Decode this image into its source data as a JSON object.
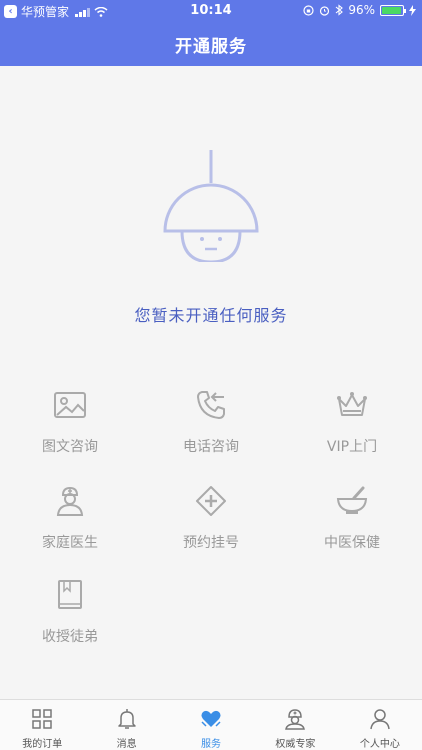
{
  "status_bar": {
    "app_back": "华预管家",
    "time": "10:14",
    "battery": "96%"
  },
  "header": {
    "title": "开通服务"
  },
  "empty_state": {
    "message": "您暂未开通任何服务"
  },
  "services": [
    {
      "label": "图文咨询",
      "icon": "image-icon"
    },
    {
      "label": "电话咨询",
      "icon": "phone-icon"
    },
    {
      "label": "VIP上门",
      "icon": "crown-icon"
    },
    {
      "label": "家庭医生",
      "icon": "doctor-icon"
    },
    {
      "label": "预约挂号",
      "icon": "plus-diamond-icon"
    },
    {
      "label": "中医保健",
      "icon": "mortar-icon"
    },
    {
      "label": "收授徒弟",
      "icon": "book-icon"
    }
  ],
  "tabbar": {
    "items": [
      {
        "label": "我的订单",
        "icon": "grid-icon"
      },
      {
        "label": "消息",
        "icon": "bell-icon"
      },
      {
        "label": "服务",
        "icon": "heart-icon"
      },
      {
        "label": "权威专家",
        "icon": "expert-icon"
      },
      {
        "label": "个人中心",
        "icon": "person-icon"
      }
    ],
    "active_index": 2
  },
  "colors": {
    "accent": "#5f78e8",
    "active_tab": "#3a8ee6",
    "icon_gray": "#aaaaaa"
  }
}
